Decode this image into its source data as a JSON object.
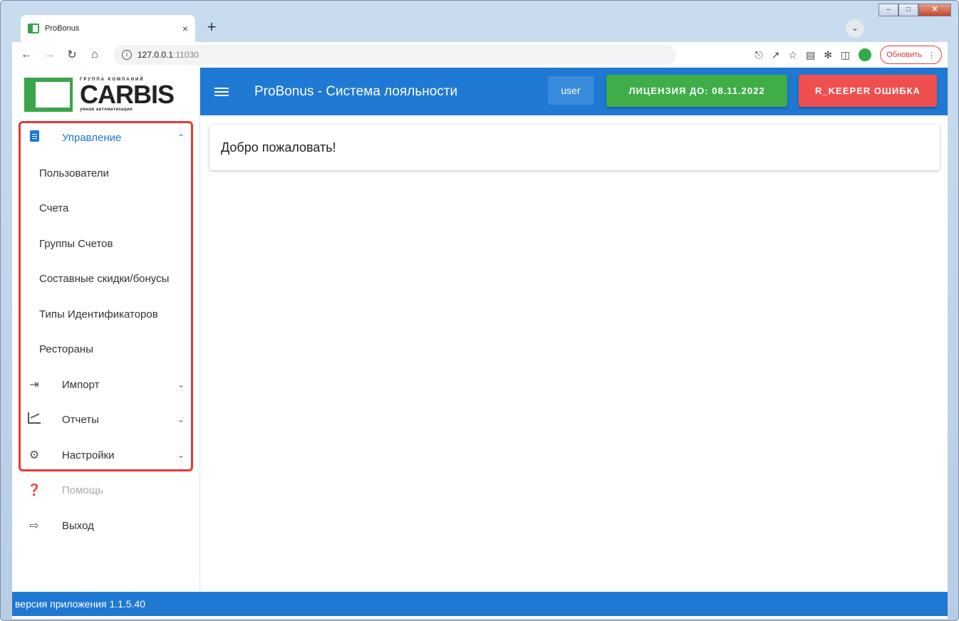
{
  "browser": {
    "tab_title": "ProBonus",
    "tab_close": "×",
    "new_tab": "+",
    "url_host": "127.0.0.1",
    "url_port": ":11030",
    "update_label": "Обновить",
    "update_menu": "⋮"
  },
  "header": {
    "title": "ProBonus - Система лояльности",
    "user_label": "user",
    "license_label": "ЛИЦЕНЗИЯ ДО: 08.11.2022",
    "rkeeper_label": "R_KEEPER ОШИБКА"
  },
  "logo": {
    "top_text": "ГРУППА КОМПАНИЙ",
    "name": "CARBIS",
    "tagline": "умная автоматизация"
  },
  "sidebar": {
    "management": {
      "label": "Управление",
      "icon": "clipboard-icon"
    },
    "sub_items": [
      {
        "label": "Пользователи"
      },
      {
        "label": "Счета"
      },
      {
        "label": "Группы Счетов"
      },
      {
        "label": "Составные скидки/бонусы"
      },
      {
        "label": "Типы Идентификаторов"
      },
      {
        "label": "Рестораны"
      }
    ],
    "import": {
      "label": "Импорт",
      "icon": "import-icon"
    },
    "reports": {
      "label": "Отчеты",
      "icon": "chart-icon"
    },
    "settings": {
      "label": "Настройки",
      "icon": "gear-icon"
    },
    "help": {
      "label": "Помощь",
      "icon": "help-icon"
    },
    "logout": {
      "label": "Выход",
      "icon": "logout-icon"
    }
  },
  "main": {
    "welcome": "Добро пожаловать!"
  },
  "footer": {
    "version": "версия приложения 1.1.5.40"
  },
  "colors": {
    "primary": "#1f78d1",
    "license": "#3fae49",
    "error": "#ef4f4f",
    "highlight": "#e53935"
  }
}
